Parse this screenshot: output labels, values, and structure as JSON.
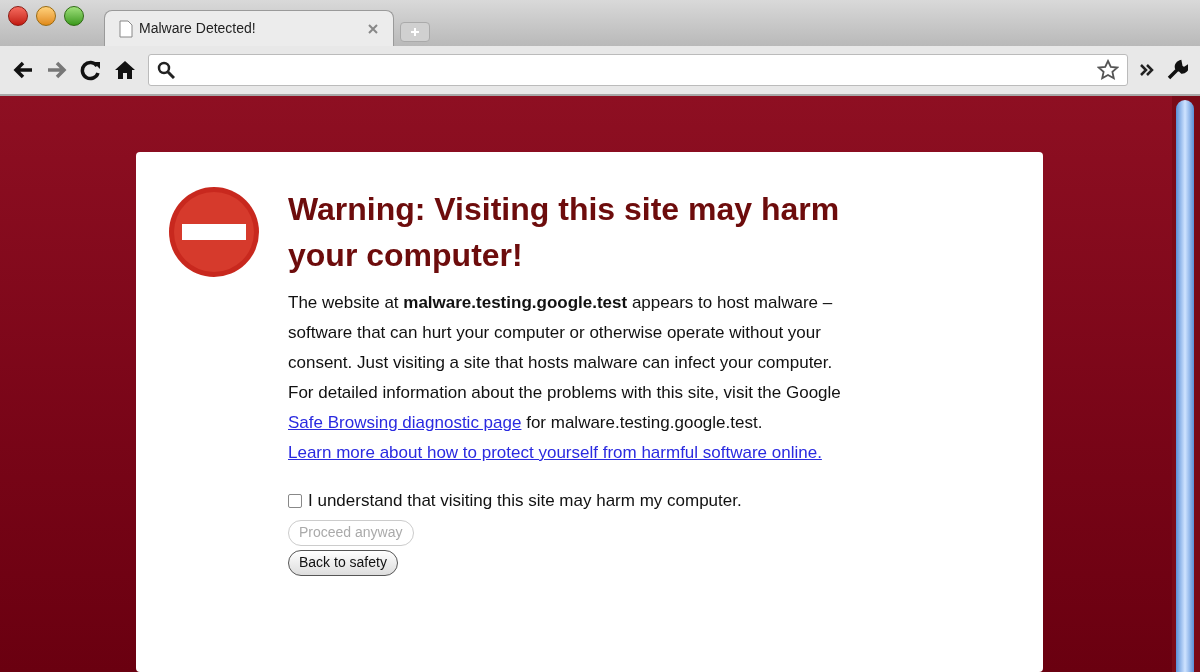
{
  "tab": {
    "title": "Malware Detected!",
    "selected": true
  },
  "page": {
    "title": "Warning: Visiting this site may harm your computer!",
    "intro": "The website at **malware.testing.google.test** appears to host malware – software that can hurt your computer or otherwise operate without your consent. Just visiting a site that hosts malware can infect your computer.",
    "details_before": "For detailed information about the problems with this site, visit the Google",
    "details_link": "Safe Browsing diagnostic page",
    "details_after": "for malware.testing.google.test.",
    "learn_more_link": "Learn more about how to protect yourself from harmful software online.",
    "checkbox": {
      "label": "I understand that visiting this site may harm my computer.",
      "checked": false
    },
    "buttons": [
      {
        "label": "Proceed anyway",
        "disabled": true
      },
      {
        "label": "Back to safety",
        "disabled": false
      }
    ]
  }
}
